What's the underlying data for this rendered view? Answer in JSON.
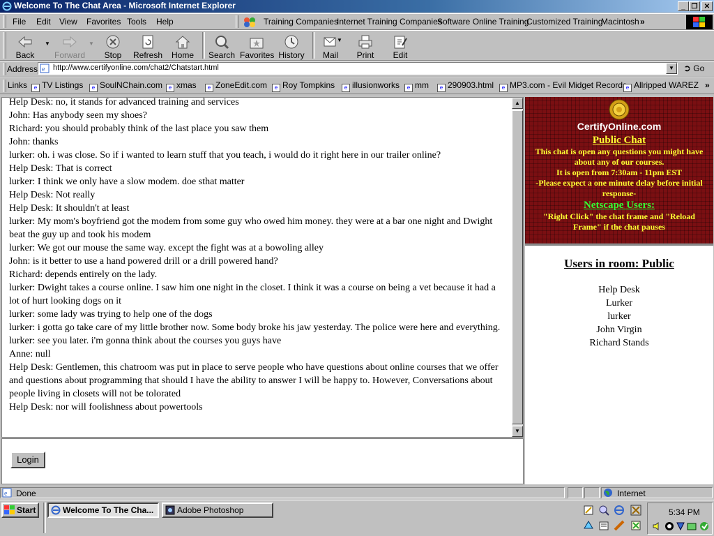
{
  "window": {
    "title": "Welcome To The Chat Area - Microsoft Internet Explorer",
    "controls": [
      "_",
      "❐",
      "✕"
    ]
  },
  "menu": [
    "File",
    "Edit",
    "View",
    "Favorites",
    "Tools",
    "Help"
  ],
  "menu_links": [
    "Training Companies",
    "Internet Training Companies",
    "Software Online Training",
    "Customized Training",
    "Macintosh",
    "»"
  ],
  "toolbar": [
    {
      "label": "Back",
      "icon": "back-arrow-icon"
    },
    {
      "label": "Forward",
      "icon": "forward-arrow-icon"
    },
    {
      "label": "Stop",
      "icon": "stop-icon"
    },
    {
      "label": "Refresh",
      "icon": "refresh-icon"
    },
    {
      "label": "Home",
      "icon": "home-icon"
    },
    {
      "label": "Search",
      "icon": "search-icon"
    },
    {
      "label": "Favorites",
      "icon": "favorites-icon"
    },
    {
      "label": "History",
      "icon": "history-icon"
    },
    {
      "label": "Mail",
      "icon": "mail-icon"
    },
    {
      "label": "Print",
      "icon": "print-icon"
    },
    {
      "label": "Edit",
      "icon": "edit-icon"
    }
  ],
  "address": {
    "label": "Address",
    "url": "http://www.certifyonline.com/chat2/Chatstart.html",
    "go": "Go"
  },
  "links_bar": {
    "label": "Links",
    "items": [
      "TV Listings",
      "SoulNChain.com",
      "xmas",
      "ZoneEdit.com",
      "Roy Tompkins",
      "illusionworks",
      "mm",
      "290903.html",
      "MP3.com - Evil Midget Records",
      "Allripped WAREZ",
      "»"
    ]
  },
  "chat": {
    "messages": [
      "Help Desk: no, it stands for advanced training and services",
      "John: Has anybody seen my shoes?",
      "Richard: you should probably think of the last place you saw them",
      "John: thanks",
      "lurker: oh. i was close. So if i wanted to learn stuff that you teach, i would do it right here in our trailer online?",
      "Help Desk: That is correct",
      "lurker: I think we only have a slow modem. doe sthat matter",
      "Help Desk: Not really",
      "Help Desk: It shouldn't at least",
      "lurker: My mom's boyfriend got the modem from some guy who owed him money. they were at a bar one night and Dwight beat the guy up and took his modem",
      "lurker: We got our mouse the same way. except the fight was at a bowoling alley",
      "John: is it better to use a hand powered drill or a drill powered hand?",
      "Richard: depends entirely on the lady.",
      "lurker: Dwight takes a course online. I saw him one night in the closet. I think it was a course on being a vet because it had a lot of hurt looking dogs on it",
      "lurker: some lady was trying to help one of the dogs",
      "lurker: i gotta go take care of my little brother now. Some body broke his jaw yesterday. The police were here and everything.",
      "lurker: see you later. i'm gonna think about the courses you guys have",
      "Anne: null",
      "Help Desk: Gentlemen, this chatroom was put in place to serve people who have questions about online courses that we offer and questions about programming that should I have the ability to answer I will be happy to. However, Conversations about people living in closets will not be tolorated",
      "Help Desk: nor will foolishness about powertools"
    ],
    "login_label": "Login"
  },
  "promo": {
    "logo_text": "CertifyOnline.com",
    "heading": "Public Chat",
    "line1": "This chat is open  any questions you might have about any of our courses.",
    "line2": "It is open from 7:30am - 11pm EST",
    "line3": "-Please expect a one minute delay before initial response-",
    "netscape_heading": "Netscape Users:",
    "netscape_text": "\"Right Click\" the chat frame and \"Reload Frame\" if the chat pauses",
    "colors": {
      "bg": "#7a0f12",
      "yellow": "#ffff33",
      "green": "#33ff33"
    }
  },
  "users": {
    "title": "Users in room: Public",
    "list": [
      "Help Desk",
      "Lurker",
      "lurker",
      "John Virgin",
      "Richard Stands"
    ]
  },
  "status": {
    "text": "Done",
    "zone": "Internet"
  },
  "taskbar": {
    "start": "Start",
    "tasks": [
      "Welcome To The Cha...",
      "Adobe Photoshop"
    ],
    "clock": "5:34 PM"
  }
}
